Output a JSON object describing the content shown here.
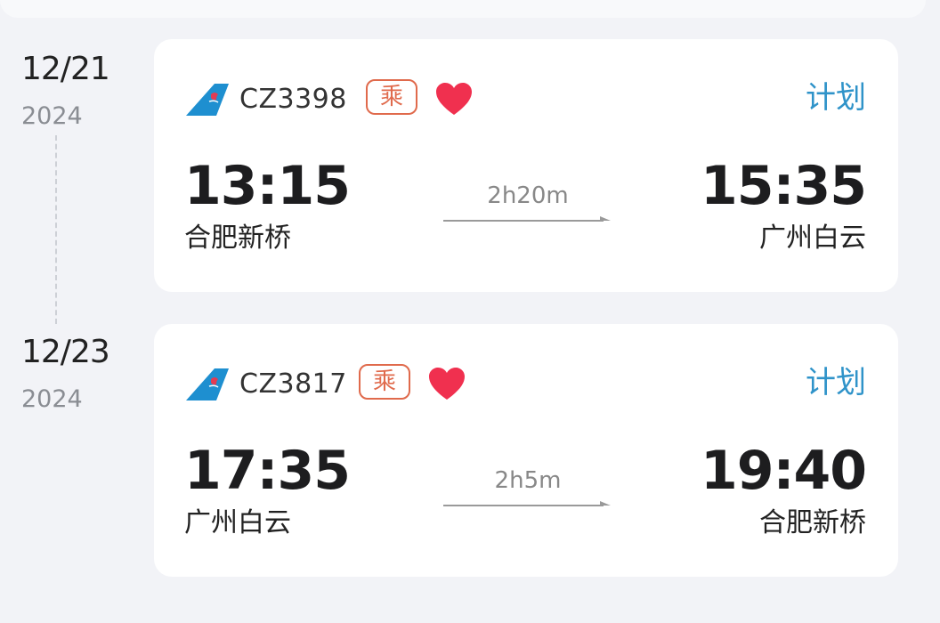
{
  "flights": [
    {
      "date": "12/21",
      "year": "2024",
      "flight_no": "CZ3398",
      "badge": "乘",
      "status": "计划",
      "dep_time": "13:15",
      "dep_airport": "合肥新桥",
      "duration": "2h20m",
      "arr_time": "15:35",
      "arr_airport": "广州白云"
    },
    {
      "date": "12/23",
      "year": "2024",
      "flight_no": "CZ3817",
      "badge": "乘",
      "status": "计划",
      "dep_time": "17:35",
      "dep_airport": "广州白云",
      "duration": "2h5m",
      "arr_time": "19:40",
      "arr_airport": "合肥新桥"
    }
  ],
  "colors": {
    "status_blue": "#2f93c9",
    "badge_orange": "#e06a4c",
    "heart_red": "#f0304f",
    "logo_blue": "#1e8fd0"
  },
  "icons": {
    "airline_logo": "china-southern-tail-icon",
    "favorite": "heart-icon",
    "duration_arrow": "arrow-right-icon"
  }
}
